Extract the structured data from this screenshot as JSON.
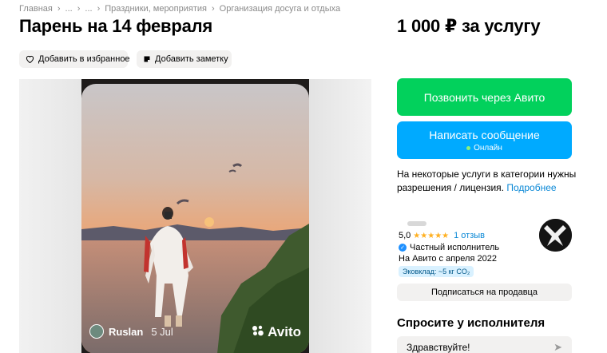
{
  "breadcrumbs": [
    "Главная",
    "...",
    "...",
    "Праздники, мероприятия",
    "Организация досуга и отдыха"
  ],
  "title": "Парень на 14 февраля",
  "price": "1 000 ₽ за услугу",
  "actions": {
    "favorite": "Добавить в избранное",
    "note": "Добавить заметку"
  },
  "photo": {
    "author": "Ruslan",
    "date": "5 Jul",
    "logo": "Avito"
  },
  "contact": {
    "call": "Позвонить через Авито",
    "message": "Написать сообщение",
    "online": "Онлайн"
  },
  "license": {
    "text": "На некоторые услуги в категории нужны разрешения / лицензия.",
    "link": "Подробнее"
  },
  "seller": {
    "rating": "5,0",
    "stars": "★★★★★",
    "reviews": "1 отзыв",
    "type": "Частный исполнитель",
    "since": "На Авито с апреля 2022",
    "eco": "Эковклад: ~5 кг CO₂",
    "subscribe": "Подписаться на продавца"
  },
  "ask": {
    "title": "Спросите у исполнителя",
    "input_value": "Здравствуйте!"
  },
  "colors": {
    "call_button": "#02d15c",
    "message_button": "#00aaff",
    "link": "#0a88d6",
    "stars": "#ffb021"
  }
}
